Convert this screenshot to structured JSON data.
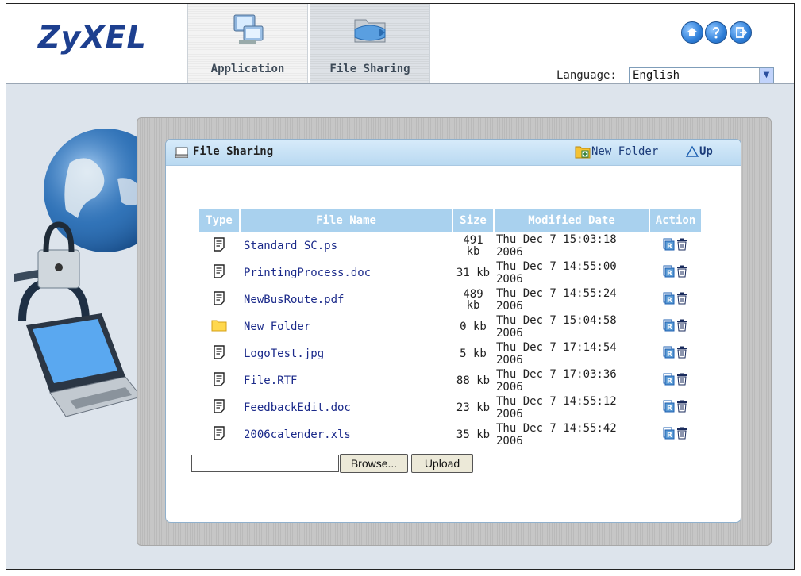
{
  "header": {
    "logo": "ZyXEL",
    "tabs": [
      {
        "label": "Application",
        "icon": "application-icon"
      },
      {
        "label": "File Sharing",
        "icon": "file-sharing-icon"
      }
    ],
    "icons": [
      "home-icon",
      "help-icon",
      "logout-icon"
    ],
    "language_label": "Language:",
    "language_value": "English"
  },
  "panel": {
    "title": "File Sharing",
    "new_folder_label": "New Folder",
    "up_label": "Up",
    "columns": [
      "Type",
      "File Name",
      "Size",
      "Modified Date",
      "Action"
    ],
    "files": [
      {
        "type": "file",
        "name": "Standard_SC.ps",
        "size": "491 kb",
        "modified": "Thu Dec 7 15:03:18 2006"
      },
      {
        "type": "file",
        "name": "PrintingProcess.doc",
        "size": "31 kb",
        "modified": "Thu Dec 7 14:55:00 2006"
      },
      {
        "type": "file",
        "name": "NewBusRoute.pdf",
        "size": "489 kb",
        "modified": "Thu Dec 7 14:55:24 2006"
      },
      {
        "type": "folder",
        "name": "New Folder",
        "size": "0 kb",
        "modified": "Thu Dec 7 15:04:58 2006"
      },
      {
        "type": "file",
        "name": "LogoTest.jpg",
        "size": "5 kb",
        "modified": "Thu Dec 7 17:14:54 2006"
      },
      {
        "type": "file",
        "name": "File.RTF",
        "size": "88 kb",
        "modified": "Thu Dec 7 17:03:36 2006"
      },
      {
        "type": "file",
        "name": "FeedbackEdit.doc",
        "size": "23 kb",
        "modified": "Thu Dec 7 14:55:12 2006"
      },
      {
        "type": "file",
        "name": "2006calender.xls",
        "size": "35 kb",
        "modified": "Thu Dec 7 14:55:42 2006"
      }
    ],
    "upload": {
      "input_value": "",
      "browse_label": "Browse...",
      "upload_label": "Upload"
    }
  }
}
